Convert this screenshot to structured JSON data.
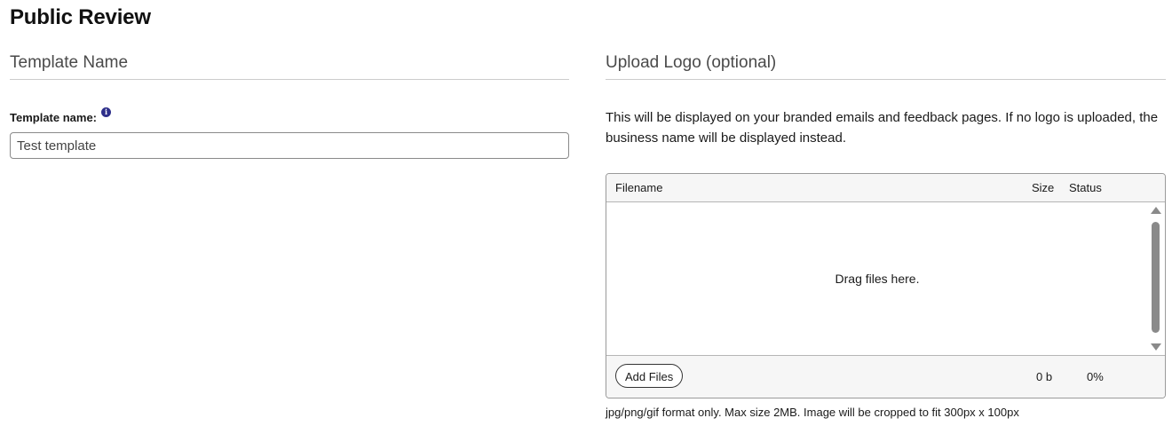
{
  "page": {
    "title": "Public Review"
  },
  "template_section": {
    "heading": "Template Name",
    "field_label": "Template name:",
    "info_icon_glyph": "i",
    "input_value": "Test template"
  },
  "logo_section": {
    "heading": "Upload Logo (optional)",
    "description": "This will be displayed on your branded emails and feedback pages. If no logo is uploaded, the business name will be displayed instead.",
    "uploader": {
      "columns": {
        "filename": "Filename",
        "size": "Size",
        "status": "Status"
      },
      "drop_text": "Drag files here.",
      "add_files_label": "Add Files",
      "total_size": "0 b",
      "total_status": "0%"
    },
    "note": "jpg/png/gif format only. Max size 2MB. Image will be cropped to fit 300px x 100px"
  },
  "colors": {
    "info_icon": "#2e2f8a",
    "scrollbar": "#8a8a8a",
    "panel_background": "#f6f6f6"
  }
}
